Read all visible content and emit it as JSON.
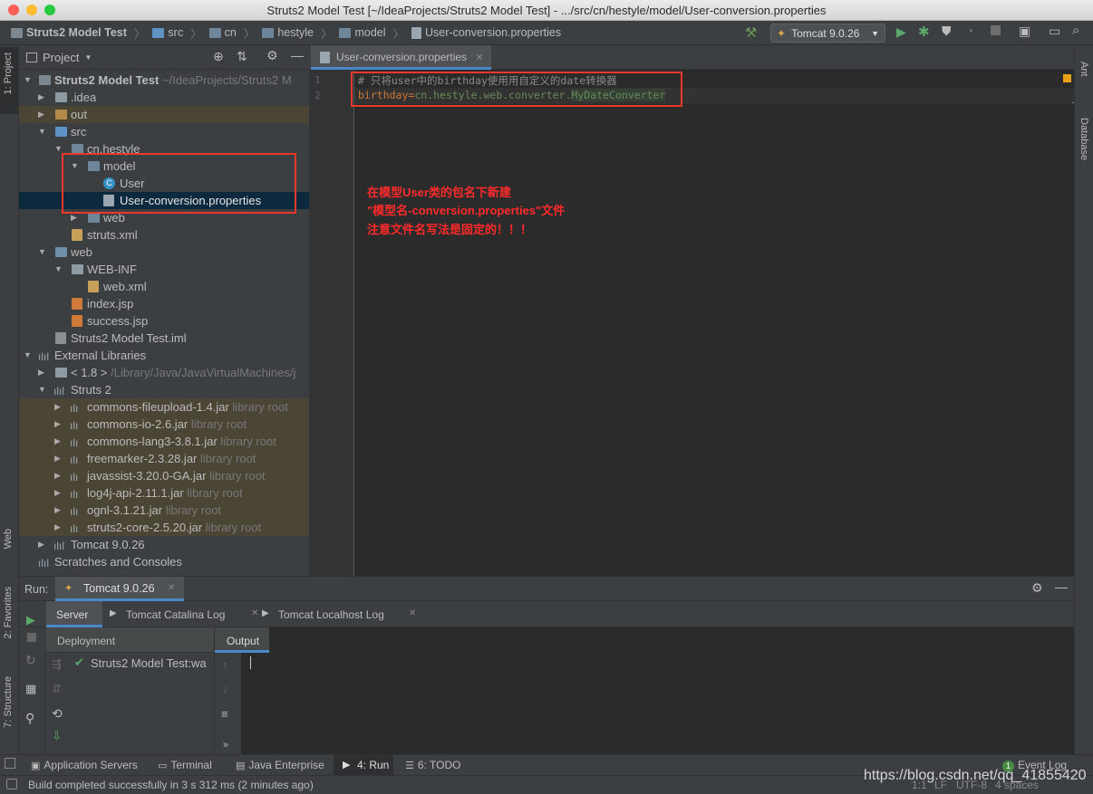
{
  "window": {
    "title": "Struts2 Model Test [~/IdeaProjects/Struts2 Model Test] - .../src/cn/hestyle/model/User-conversion.properties"
  },
  "breadcrumb": {
    "items": [
      "Struts2 Model Test",
      "src",
      "cn",
      "hestyle",
      "model",
      "User-conversion.properties"
    ]
  },
  "toolbar": {
    "run_config": "Tomcat 9.0.26"
  },
  "left_strip": {
    "project": "1: Project",
    "web": "Web",
    "favorites": "2: Favorites",
    "structure": "7: Structure"
  },
  "right_strip": {
    "ant": "Ant",
    "database": "Database"
  },
  "project_panel": {
    "title": "Project",
    "tree": [
      {
        "label": "Struts2 Model Test",
        "extra": "~/IdeaProjects/Struts2 M"
      },
      {
        "label": ".idea"
      },
      {
        "label": "out"
      },
      {
        "label": "src"
      },
      {
        "label": "cn.hestyle"
      },
      {
        "label": "model"
      },
      {
        "label": "User"
      },
      {
        "label": "User-conversion.properties"
      },
      {
        "label": "web"
      },
      {
        "label": "struts.xml"
      },
      {
        "label": "web"
      },
      {
        "label": "WEB-INF"
      },
      {
        "label": "web.xml"
      },
      {
        "label": "index.jsp"
      },
      {
        "label": "success.jsp"
      },
      {
        "label": "Struts2 Model Test.iml"
      },
      {
        "label": "External Libraries"
      },
      {
        "label": "< 1.8 >",
        "extra": "/Library/Java/JavaVirtualMachines/j"
      },
      {
        "label": "Struts 2"
      },
      {
        "label": "commons-fileupload-1.4.jar",
        "extra": "library root"
      },
      {
        "label": "commons-io-2.6.jar",
        "extra": "library root"
      },
      {
        "label": "commons-lang3-3.8.1.jar",
        "extra": "library root"
      },
      {
        "label": "freemarker-2.3.28.jar",
        "extra": "library root"
      },
      {
        "label": "javassist-3.20.0-GA.jar",
        "extra": "library root"
      },
      {
        "label": "log4j-api-2.11.1.jar",
        "extra": "library root"
      },
      {
        "label": "ognl-3.1.21.jar",
        "extra": "library root"
      },
      {
        "label": "struts2-core-2.5.20.jar",
        "extra": "library root"
      },
      {
        "label": "Tomcat 9.0.26"
      },
      {
        "label": "Scratches and Consoles"
      }
    ]
  },
  "editor": {
    "tab": "User-conversion.properties",
    "lines": [
      {
        "num": "1",
        "text": "# 只将user中的birthday使用用自定义的date转换器"
      },
      {
        "num": "2",
        "key": "birthday",
        "eq": "=",
        "value_pkg": "cn.hestyle.web.converter.",
        "value_cls": "MyDateConverter"
      }
    ],
    "annotation": [
      "在模型User类的包名下新建",
      "\"模型名-conversion.properties\"文件",
      "注意文件名写法是固定的！！！"
    ]
  },
  "run_panel": {
    "label": "Run:",
    "tab": "Tomcat 9.0.26",
    "subtabs": [
      "Server",
      "Tomcat Catalina Log",
      "Tomcat Localhost Log"
    ],
    "deployment_header": "Deployment",
    "output_header": "Output",
    "deployment_item": "Struts2 Model Test:wa"
  },
  "bottom_tabs": [
    "Application Servers",
    "Terminal",
    "Java Enterprise",
    "4: Run",
    "6: TODO"
  ],
  "event_log": {
    "label": "Event Log",
    "count": "1"
  },
  "status": {
    "message": "Build completed successfully in 3 s 312 ms (2 minutes ago)",
    "position": "1:1",
    "line_sep": "LF",
    "encoding": "UTF-8",
    "indent": "4 spaces"
  },
  "watermark": "https://blog.csdn.net/qq_41855420",
  "colors": {
    "accent": "#4a88c7",
    "annotation": "#ff2a2a",
    "selection": "#0d293e",
    "library_bg": "#4a4535"
  }
}
